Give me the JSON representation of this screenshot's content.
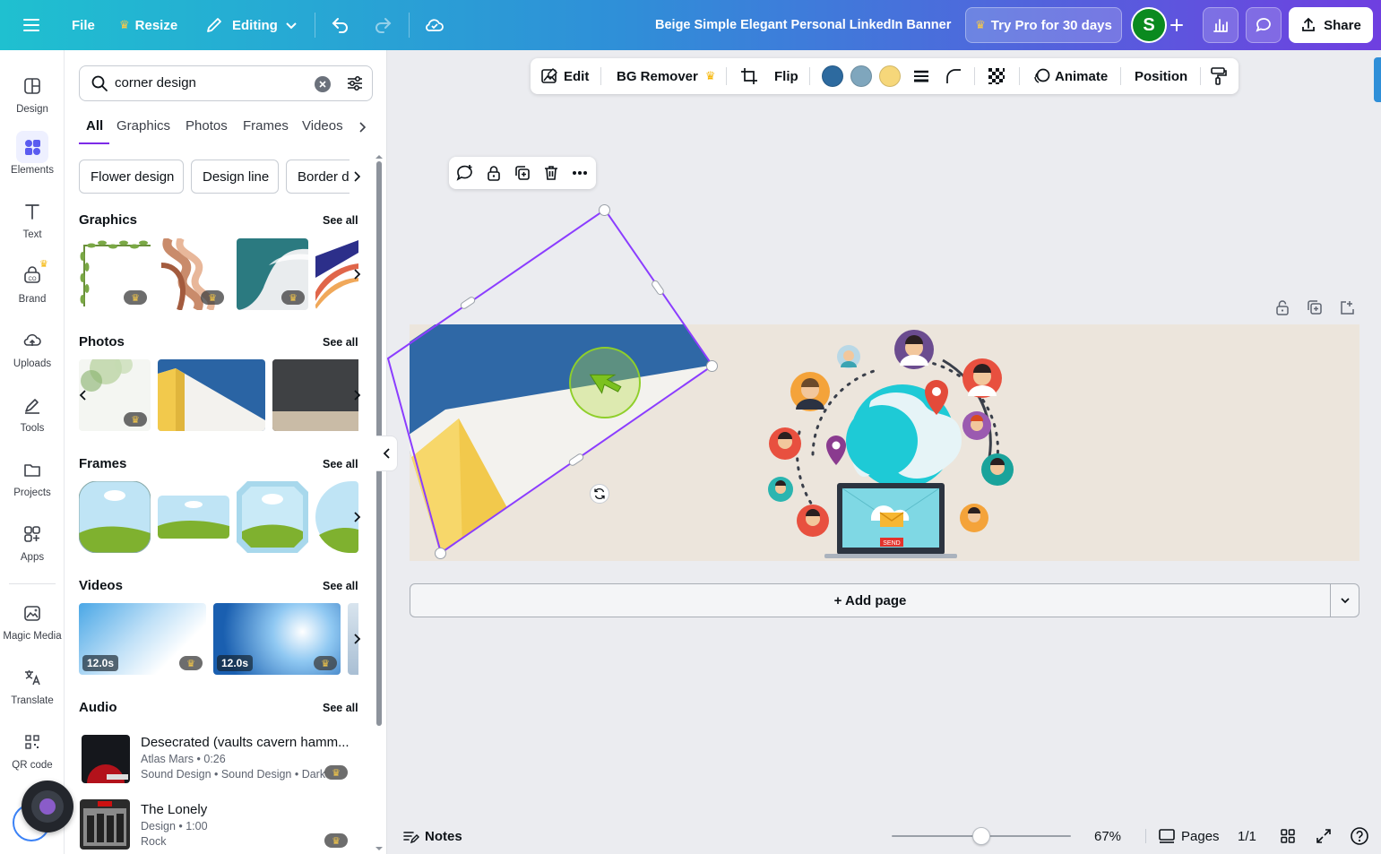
{
  "topbar": {
    "file_label": "File",
    "resize_label": "Resize",
    "editing_label": "Editing",
    "doc_title": "Beige Simple Elegant Personal LinkedIn Banner",
    "try_pro_label": "Try Pro for 30 days",
    "avatar_initial": "S",
    "share_label": "Share"
  },
  "rail": {
    "items": [
      {
        "label": "Design"
      },
      {
        "label": "Elements"
      },
      {
        "label": "Text"
      },
      {
        "label": "Brand"
      },
      {
        "label": "Uploads"
      },
      {
        "label": "Tools"
      },
      {
        "label": "Projects"
      },
      {
        "label": "Apps"
      },
      {
        "label": "Magic Media"
      },
      {
        "label": "Translate"
      },
      {
        "label": "QR code"
      }
    ]
  },
  "panel": {
    "search_value": "corner design",
    "tabs": [
      "All",
      "Graphics",
      "Photos",
      "Frames",
      "Videos"
    ],
    "chips": [
      "Flower design",
      "Design line",
      "Border de"
    ],
    "sections": {
      "graphics": "Graphics",
      "photos": "Photos",
      "frames": "Frames",
      "videos": "Videos",
      "audio": "Audio"
    },
    "see_all": "See all",
    "video_durations": [
      "12.0s",
      "12.0s"
    ],
    "audio": [
      {
        "title": "Desecrated (vaults cavern hamm...",
        "meta": "Atlas Mars • 0:26",
        "tags": "Sound Design • Sound Design • Dark"
      },
      {
        "title": "The Lonely",
        "meta": "Design • 1:00",
        "tags": "Rock"
      }
    ]
  },
  "context_toolbar": {
    "edit": "Edit",
    "bg_remover": "BG Remover",
    "flip": "Flip",
    "animate": "Animate",
    "position": "Position",
    "colors": [
      "#2d6a9f",
      "#7fa6bd",
      "#f6d77a"
    ]
  },
  "canvas": {
    "add_page": "+ Add page",
    "send_label": "SEND"
  },
  "bottom": {
    "notes": "Notes",
    "zoom": "67%",
    "zoom_fraction": 0.5,
    "pages": "Pages",
    "page_count": "1/1"
  }
}
